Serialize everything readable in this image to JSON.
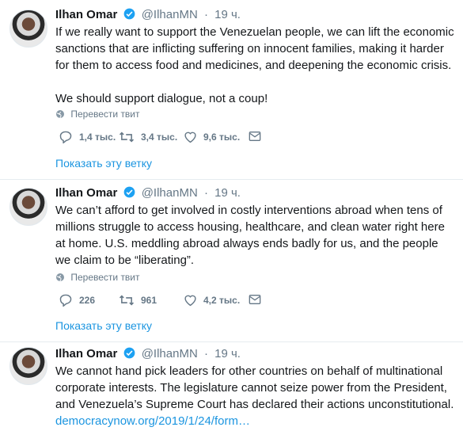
{
  "tweets": [
    {
      "name": "Ilhan Omar",
      "handle": "@IlhanMN",
      "time": "19 ч.",
      "text": [
        "If we really want to support the Venezuelan people, we can lift the economic sanctions that are inflicting suffering on innocent families, making it harder for them to access food and medicines, and deepening the economic crisis.",
        "We should support dialogue, not a coup!"
      ],
      "translate": "Перевести твит",
      "replies": "1,4 тыс.",
      "retweets": "3,4 тыс.",
      "likes": "9,6 тыс.",
      "show_thread": "Показать эту ветку"
    },
    {
      "name": "Ilhan Omar",
      "handle": "@IlhanMN",
      "time": "19 ч.",
      "text": [
        "We can’t afford to get involved in costly interventions abroad when tens of millions struggle to access housing, healthcare, and clean water right here at home. U.S. meddling abroad always ends badly for us, and the people we claim to be “liberating”."
      ],
      "translate": "Перевести твит",
      "replies": "226",
      "retweets": "961",
      "likes": "4,2 тыс.",
      "show_thread": "Показать эту ветку"
    },
    {
      "name": "Ilhan Omar",
      "handle": "@IlhanMN",
      "time": "19 ч.",
      "text": [
        "We cannot hand pick leaders for other countries on behalf of multinational corporate interests. The legislature cannot seize power from the President, and Venezuela’s Supreme Court has declared their actions unconstitutional."
      ],
      "link": "democracynow.org/2019/1/24/form…"
    }
  ],
  "colors": {
    "verified": "#1da1f2",
    "link": "#1b95e0",
    "muted": "#657786",
    "border": "#e6ecf0"
  },
  "icons": [
    "verified-badge-icon",
    "globe-icon",
    "reply-icon",
    "retweet-icon",
    "like-icon",
    "message-icon"
  ]
}
